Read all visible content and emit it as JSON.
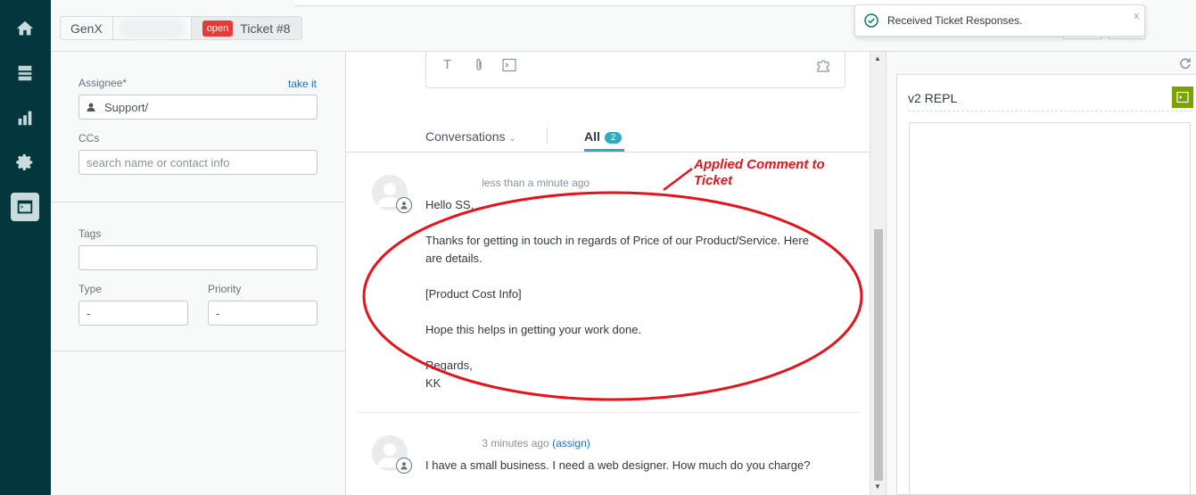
{
  "nav": {
    "items": [
      {
        "name": "home",
        "icon": "home-icon"
      },
      {
        "name": "views",
        "icon": "views-icon"
      },
      {
        "name": "reporting",
        "icon": "bar-chart-icon"
      },
      {
        "name": "admin",
        "icon": "gear-icon"
      },
      {
        "name": "apps",
        "icon": "terminal-icon",
        "active": true
      }
    ]
  },
  "header": {
    "tabs": [
      {
        "label": "GenX"
      },
      {
        "label": ""
      },
      {
        "label": "Ticket #8",
        "status": "open"
      }
    ]
  },
  "toast": {
    "message": "Received Ticket Responses.",
    "close": "x"
  },
  "properties": {
    "assignee_label": "Assignee*",
    "take_it": "take it",
    "assignee_value": "Support/",
    "ccs_label": "CCs",
    "ccs_placeholder": "search name or contact info",
    "tags_label": "Tags",
    "tags_value": "",
    "type_label": "Type",
    "type_value": "-",
    "priority_label": "Priority",
    "priority_value": "-"
  },
  "editor": {
    "tools": [
      "T",
      "attachment-icon",
      "terminal-icon",
      "puzzle-icon"
    ]
  },
  "conversation": {
    "filter_label": "Conversations",
    "all_label": "All",
    "all_count": "2",
    "comments": [
      {
        "author": "",
        "time": "less than a minute ago",
        "assign_link": "",
        "lines": [
          "Hello SS,",
          "Thanks for getting in touch in regards of Price of our Product/Service. Here",
          "are details.",
          "[Product Cost Info]",
          "Hope this helps in getting your work done.",
          "Regards,",
          "KK"
        ]
      },
      {
        "author": "",
        "time": "3 minutes ago",
        "assign_link": "(assign)",
        "lines": [
          "I have a small business. I need a web designer. How much do you charge?"
        ]
      }
    ]
  },
  "apps": {
    "title": "v2 REPL",
    "accent": "#78a300"
  },
  "annotation": {
    "text_line1": "Applied Comment to",
    "text_line2": "Ticket",
    "color": "#e3141b"
  },
  "colors": {
    "nav_bg": "#03363d",
    "open_badge": "#e43b39",
    "pill": "#30aabc",
    "link": "#1f73b7"
  }
}
